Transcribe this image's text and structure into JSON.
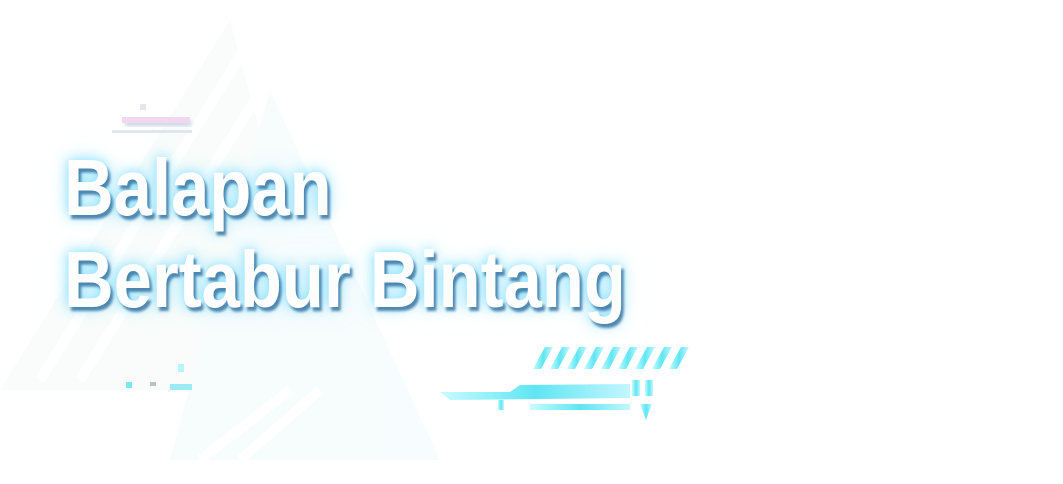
{
  "title": {
    "line1": "Balapan",
    "line2": "Bertabur Bintang"
  },
  "colors": {
    "glow": "#7fdcff",
    "accent": "#5ee8f5",
    "pink": "#f5c8f0"
  }
}
